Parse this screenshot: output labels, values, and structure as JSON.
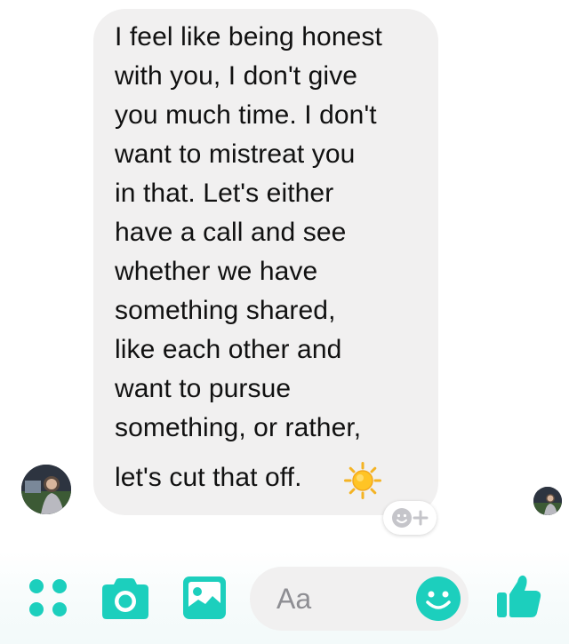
{
  "message": {
    "lines": [
      "I feel like being honest",
      "with you, I don't give",
      "you much time. I don't",
      "want to mistreat you",
      "in that. Let's either",
      "have a call and see",
      "whether we have",
      "something shared,",
      "like each other and",
      "want to pursue",
      "something, or rather,",
      "let's cut that off."
    ],
    "emoji": "sun-emoji"
  },
  "composer": {
    "placeholder": "Aa",
    "icons": [
      "apps-icon",
      "camera-icon",
      "image-icon",
      "emoji-icon",
      "thumbs-up-icon"
    ]
  },
  "colors": {
    "accent": "#1ccfbd",
    "bubble": "#f1f0f0",
    "text": "#111111",
    "placeholder": "#8e8e93"
  }
}
